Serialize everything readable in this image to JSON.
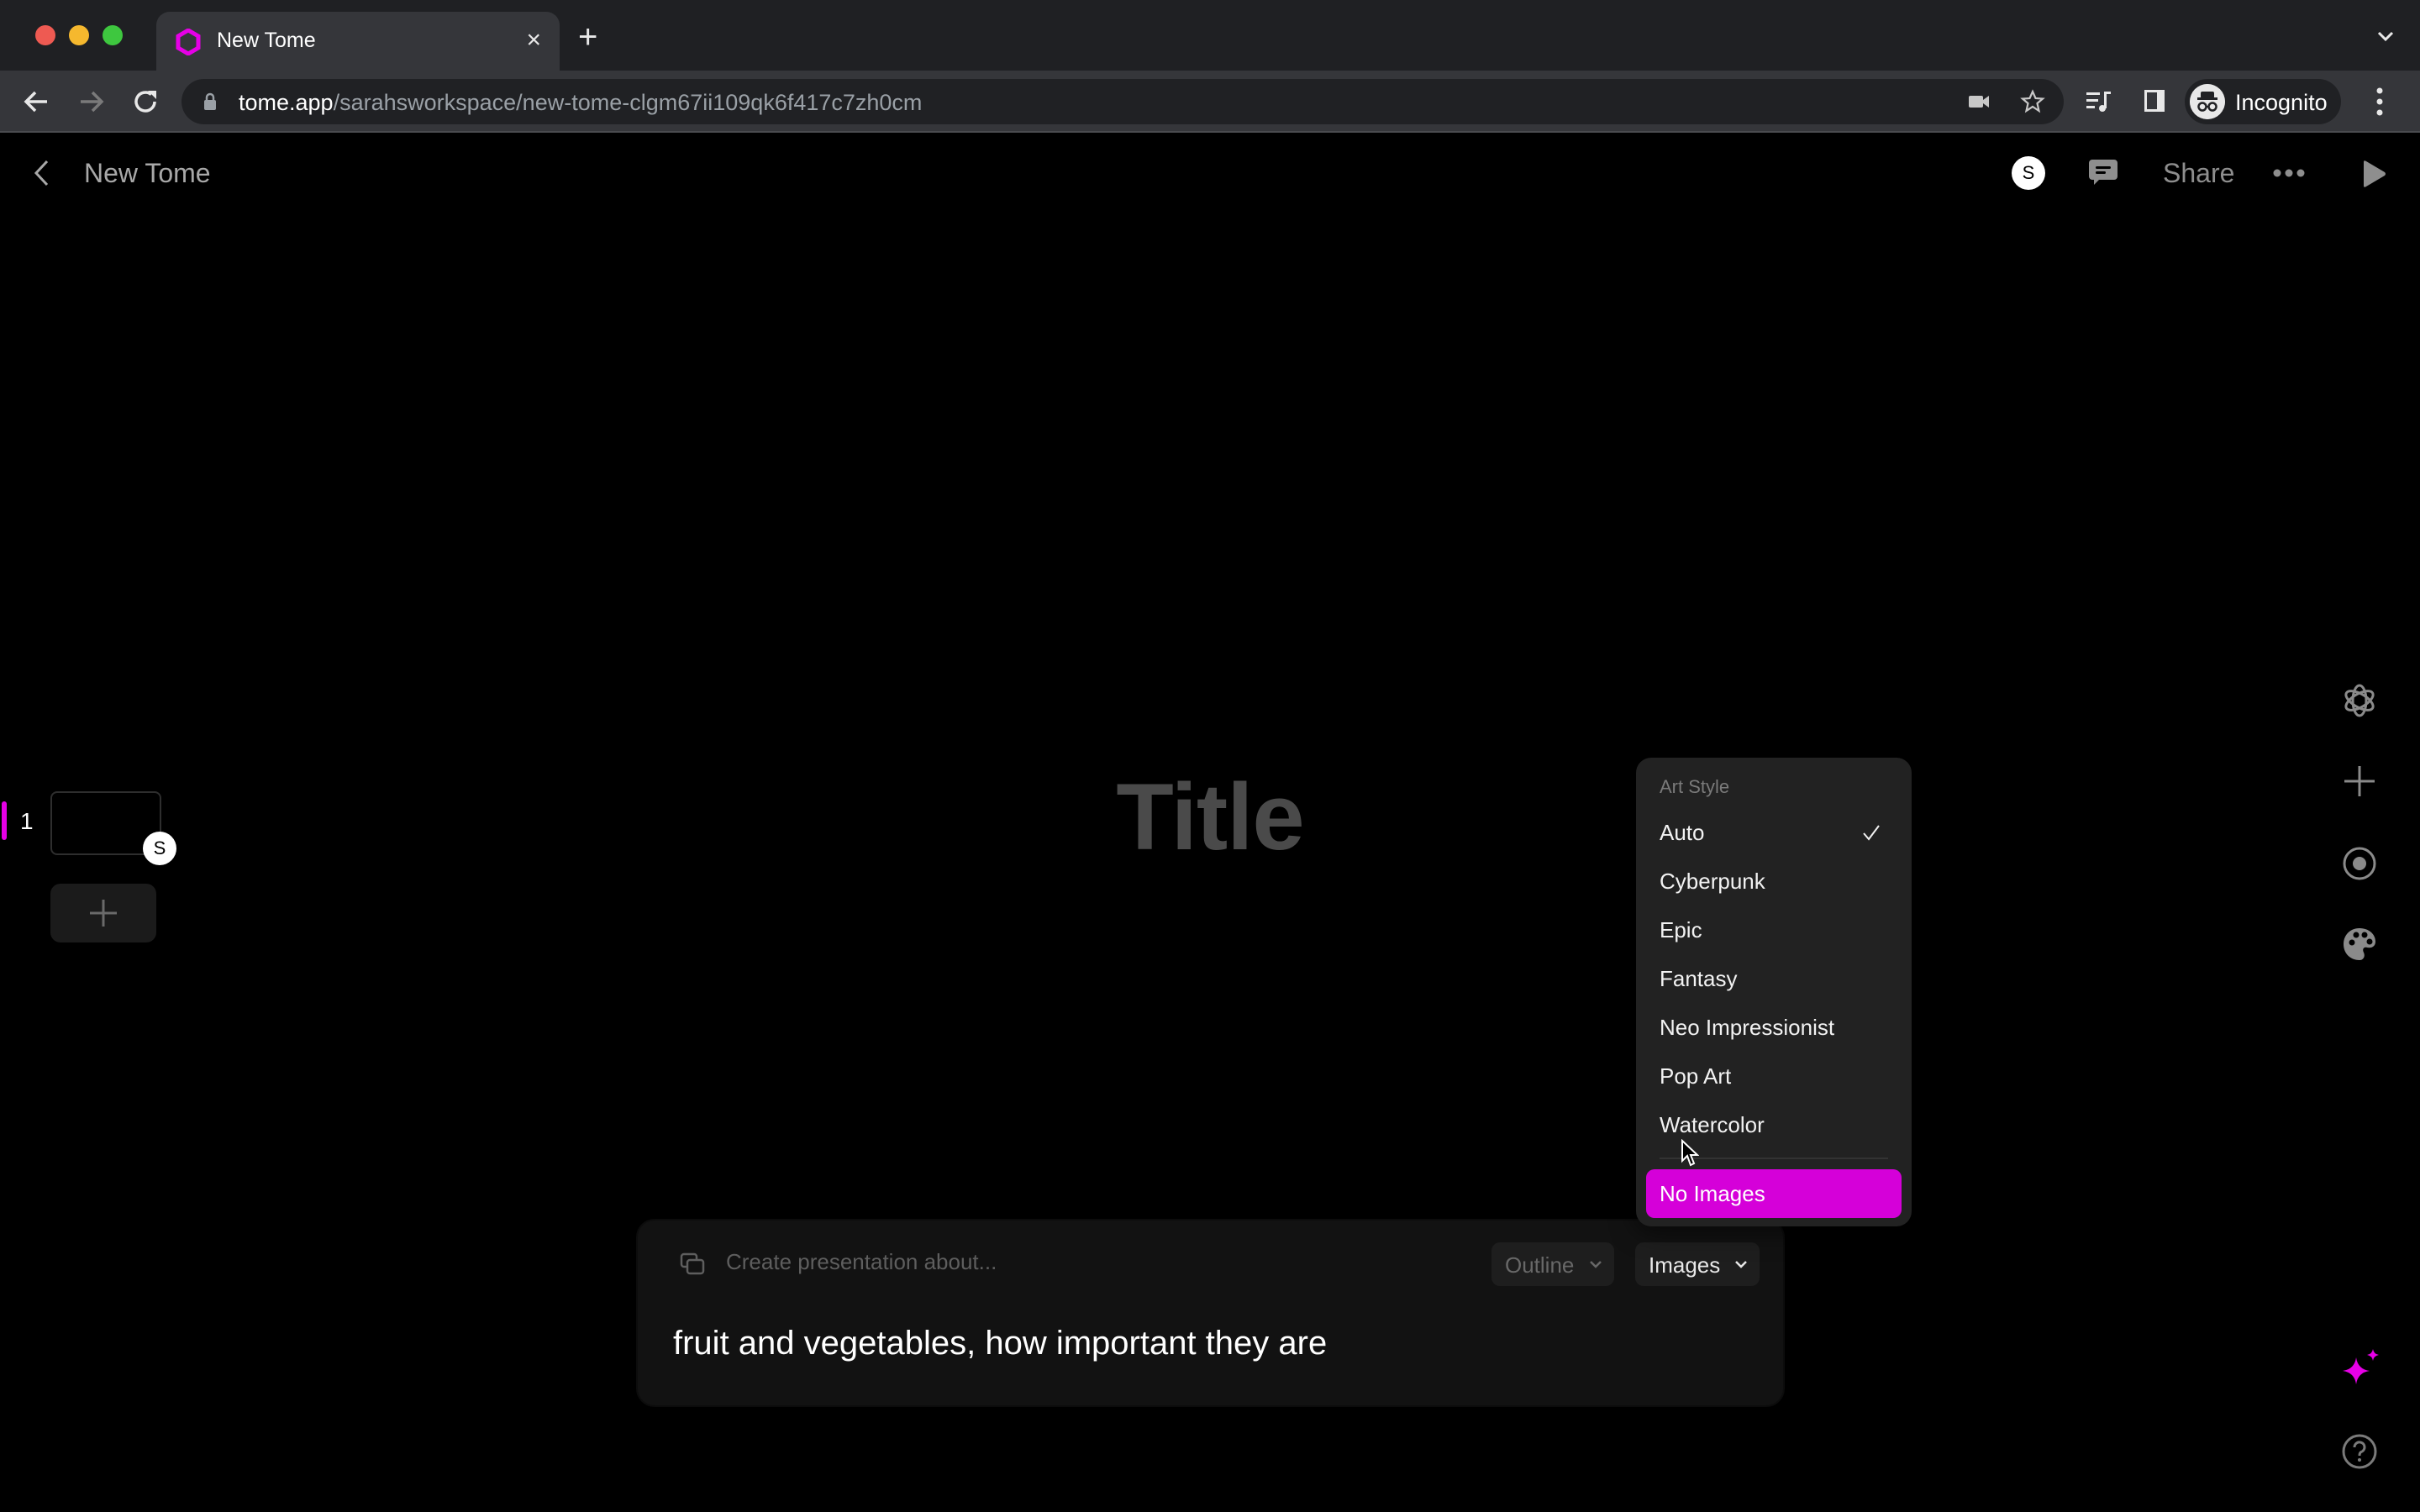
{
  "browser": {
    "tab_title": "New Tome",
    "tab_close": "×",
    "new_tab": "+",
    "url_host": "tome.app",
    "url_path": "/sarahsworkspace/new-tome-clgm67ii109qk6f417c7zh0cm",
    "profile_label": "Incognito",
    "accent": "#e600e6"
  },
  "app": {
    "title": "New Tome",
    "user_initial": "S",
    "share_label": "Share"
  },
  "sidebar": {
    "slides": [
      {
        "number": "1",
        "collaborator_initial": "S"
      }
    ]
  },
  "canvas": {
    "title_placeholder": "Title"
  },
  "art_style_menu": {
    "header": "Art Style",
    "selected": "Auto",
    "options": [
      "Auto",
      "Cyberpunk",
      "Epic",
      "Fantasy",
      "Neo Impressionist",
      "Pop Art",
      "Watercolor"
    ],
    "highlighted": "No Images",
    "highlight_color": "#d500d9"
  },
  "prompt": {
    "label": "Create presentation about...",
    "outline_label": "Outline",
    "images_label": "Images",
    "value": "fruit and vegetables, how important they are"
  }
}
